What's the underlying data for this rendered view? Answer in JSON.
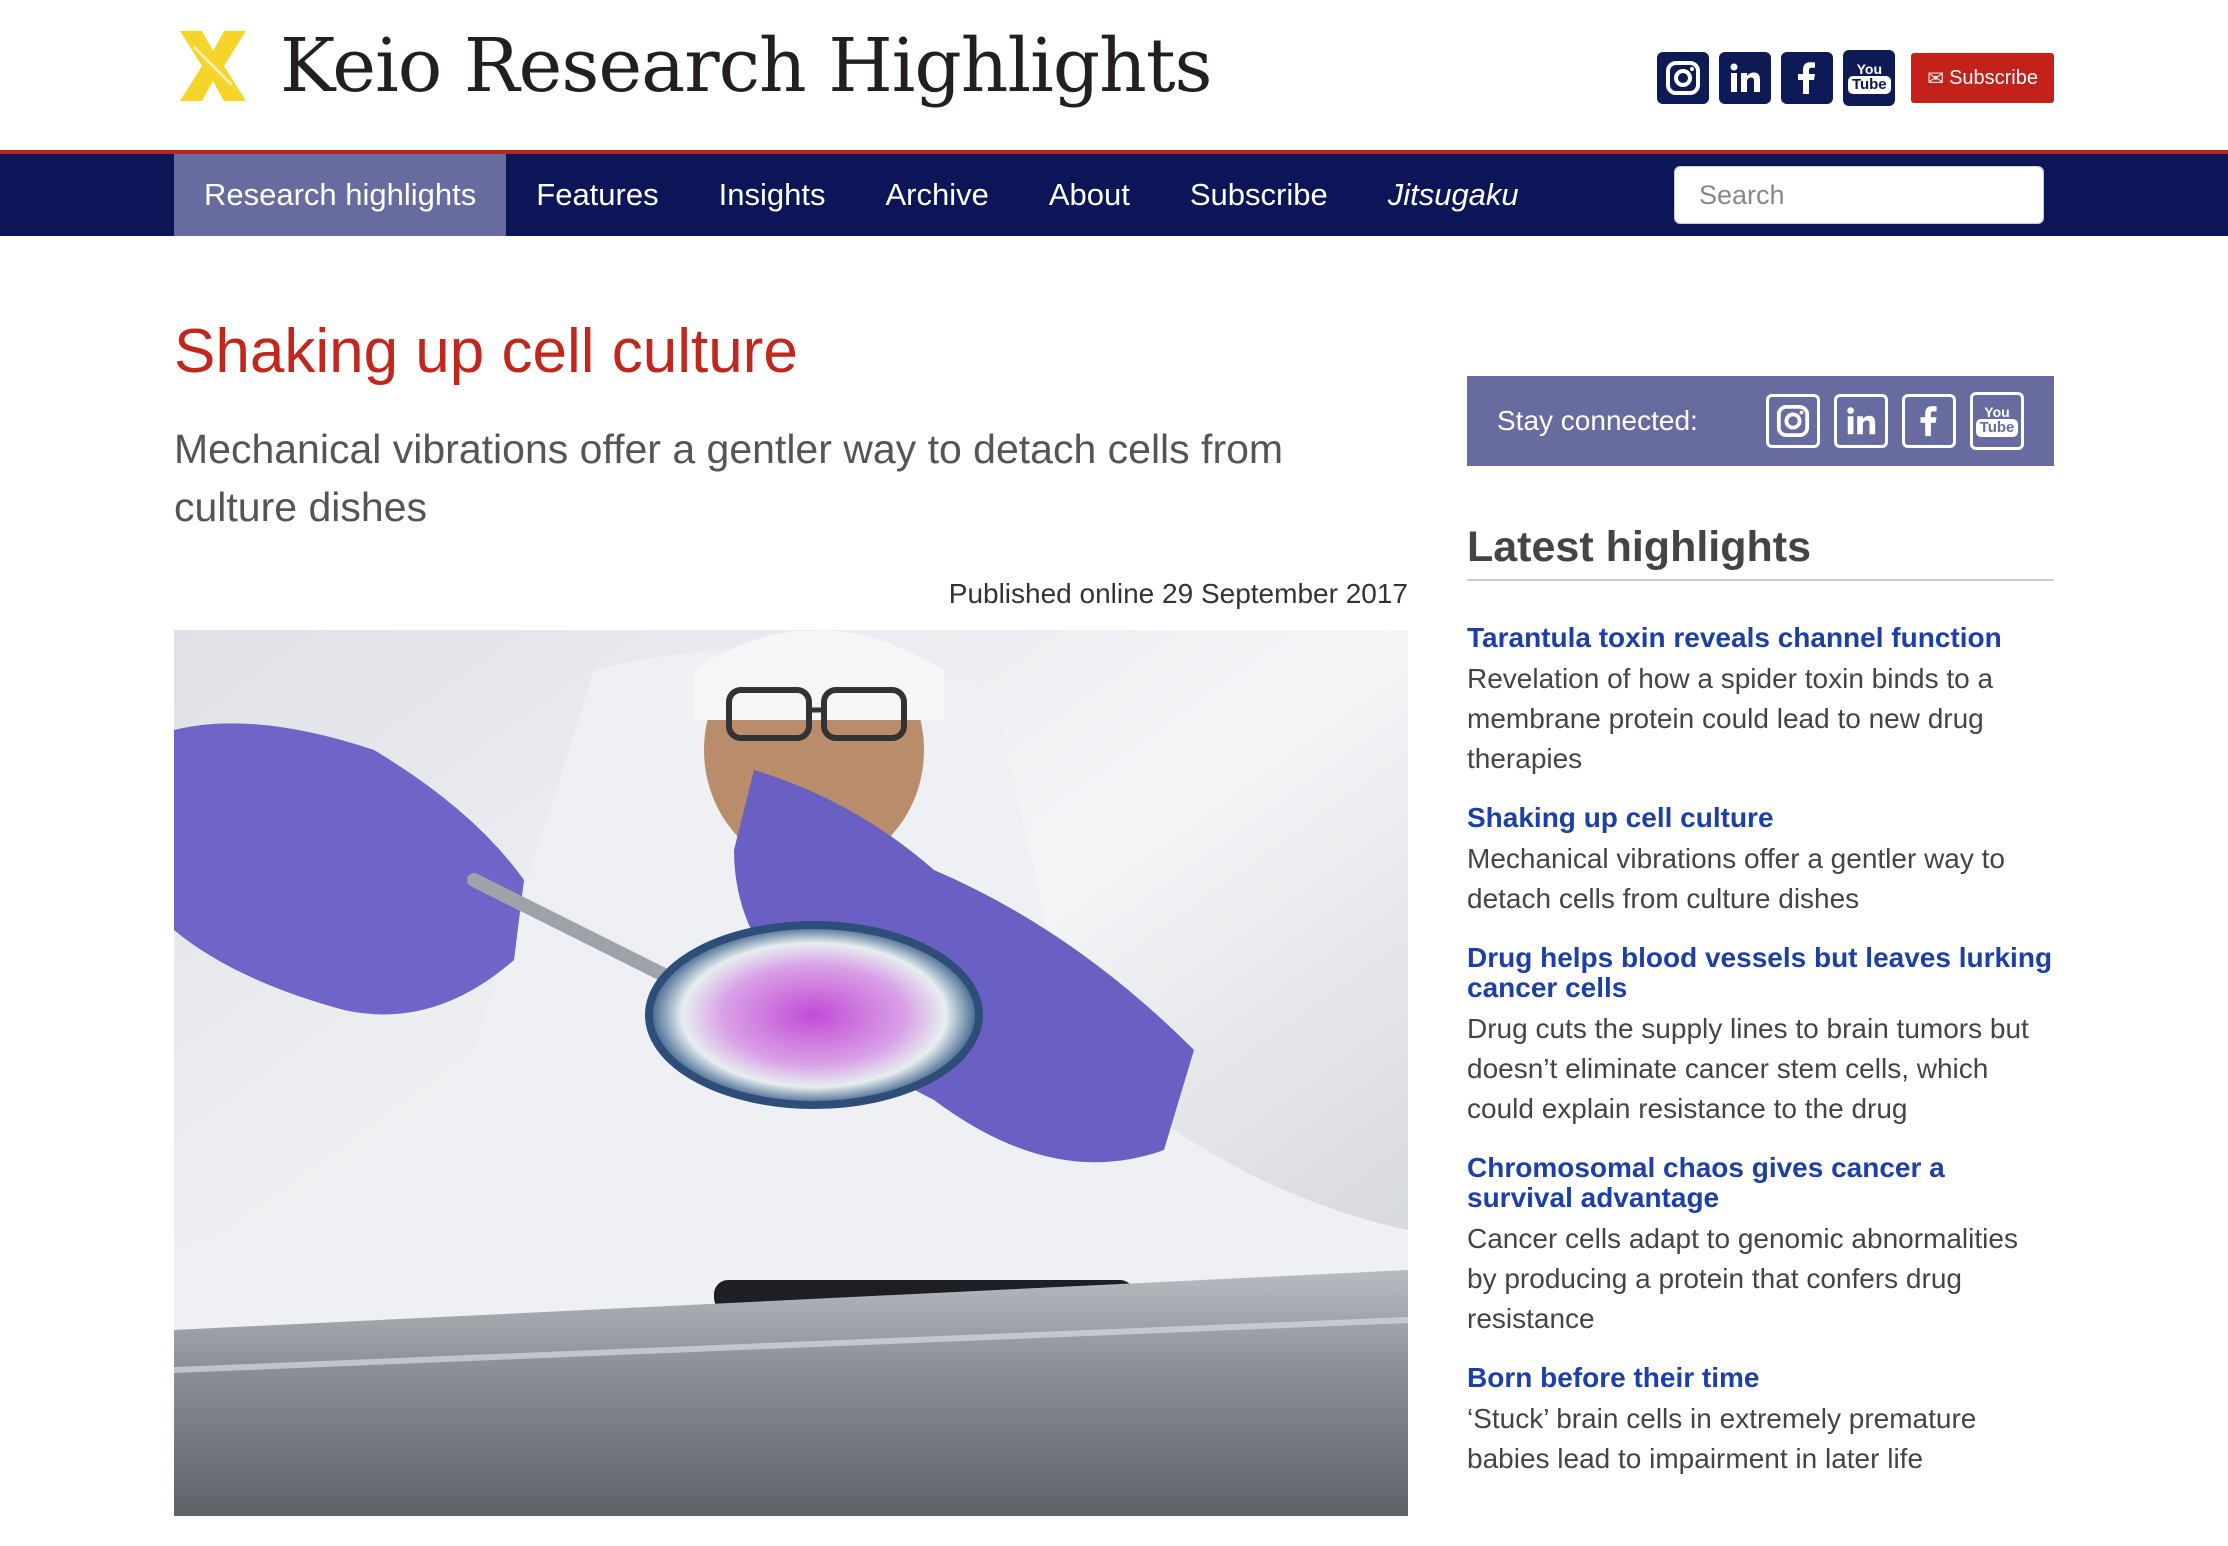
{
  "site": {
    "logo_text": "Keio Research Highlights",
    "subscribe_button": "Subscribe",
    "social": [
      "instagram-icon",
      "linkedin-icon",
      "facebook-icon",
      "youtube-icon"
    ],
    "youtube_you": "You",
    "youtube_tube": "Tube",
    "colors": {
      "accent_red": "#c1271d",
      "nav_bg": "#0b1557",
      "nav_active": "#676ba0",
      "link_blue": "#1c3fa8",
      "logo_yellow": "#f5d52a"
    }
  },
  "nav": {
    "items": [
      {
        "label": "Research highlights"
      },
      {
        "label": "Features"
      },
      {
        "label": "Insights"
      },
      {
        "label": "Archive"
      },
      {
        "label": "About"
      },
      {
        "label": "Subscribe"
      },
      {
        "label": "Jitsugaku"
      }
    ],
    "search_placeholder": "Search"
  },
  "article": {
    "title": "Shaking up cell culture",
    "subtitle": "Mechanical vibrations offer a gentler way to detach cells from culture dishes",
    "published": "Published online 29 September 2017"
  },
  "sidebar": {
    "stay_connected": "Stay connected:",
    "latest_heading": "Latest highlights",
    "highlights": [
      {
        "title": "Tarantula toxin reveals channel function",
        "desc": "Revelation of how a spider toxin binds to a membrane protein could lead to new drug therapies"
      },
      {
        "title": "Shaking up cell culture",
        "desc": "Mechanical vibrations offer a gentler way to detach cells from culture dishes"
      },
      {
        "title": "Drug helps blood vessels but leaves lurking cancer cells",
        "desc": "Drug cuts the supply lines to brain tumors but doesn’t eliminate cancer stem cells, which could explain resistance to the drug"
      },
      {
        "title": "Chromosomal chaos gives cancer a survival advantage",
        "desc": "Cancer cells adapt to genomic abnormalities by producing a protein that confers drug resistance"
      },
      {
        "title": "Born before their time",
        "desc": "‘Stuck’ brain cells in extremely premature babies lead to impairment in later life"
      }
    ]
  }
}
